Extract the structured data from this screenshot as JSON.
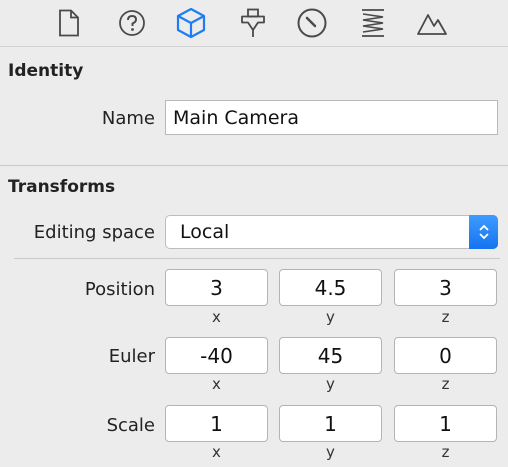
{
  "toolbar": {
    "icons": [
      "file-icon",
      "help-icon",
      "cube-icon",
      "pin-icon",
      "gauge-icon",
      "spring-icon",
      "mountain-icon"
    ],
    "active": "cube-icon",
    "accent": "#1e7df3",
    "icon_color": "#4a4a4a"
  },
  "identity": {
    "title": "Identity",
    "name_label": "Name",
    "name_value": "Main Camera"
  },
  "transforms": {
    "title": "Transforms",
    "editing_space_label": "Editing space",
    "editing_space_value": "Local",
    "rows": [
      {
        "label": "Position",
        "values": [
          "3",
          "4.5",
          "3"
        ]
      },
      {
        "label": "Euler",
        "values": [
          "-40",
          "45",
          "0"
        ]
      },
      {
        "label": "Scale",
        "values": [
          "1",
          "1",
          "1"
        ]
      }
    ],
    "axes": [
      "x",
      "y",
      "z"
    ]
  }
}
